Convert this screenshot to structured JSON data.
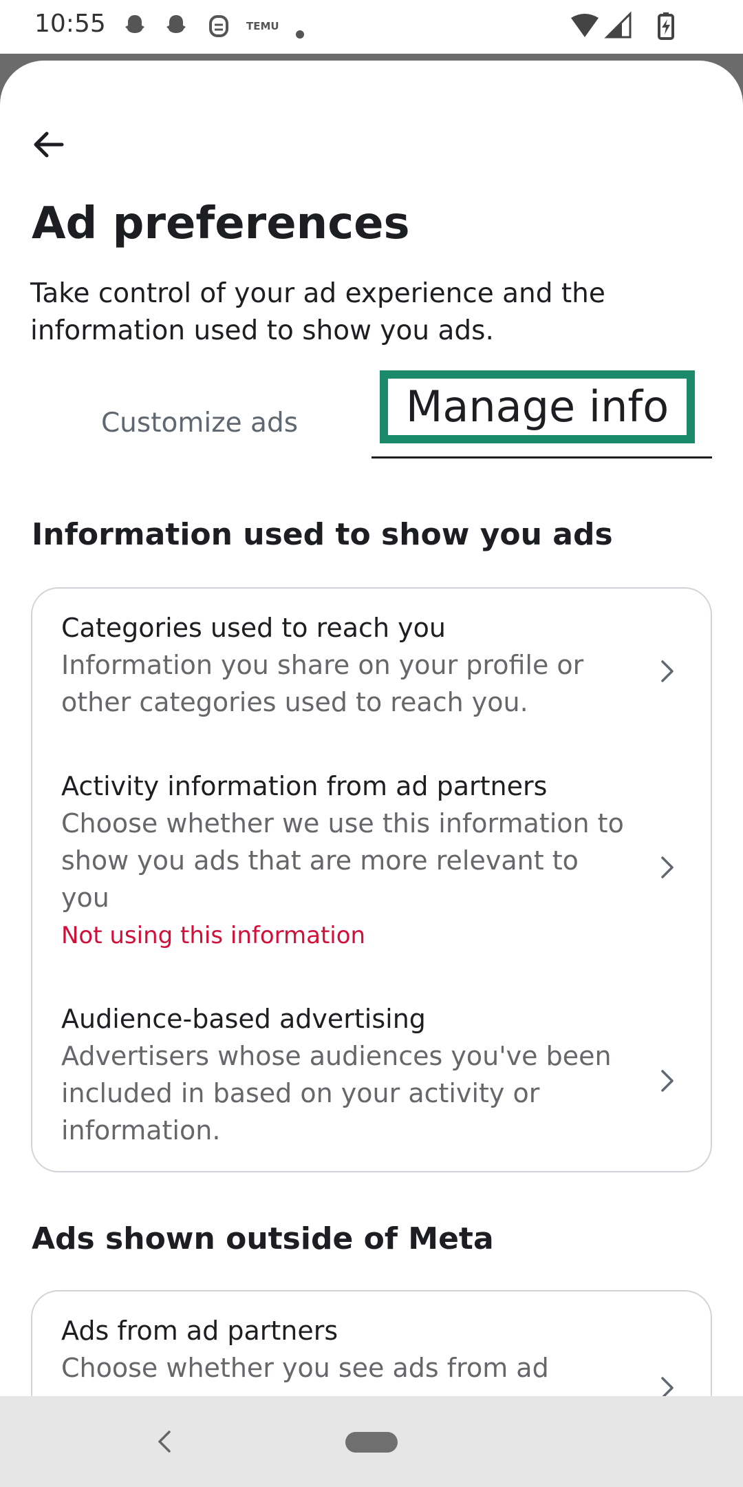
{
  "status_bar": {
    "time": "10:55",
    "temu_label": "TEMU"
  },
  "header": {
    "title": "Ad preferences",
    "subtitle": "Take control of your ad experience and the information used to show you ads."
  },
  "tabs": [
    {
      "label": "Customize ads",
      "selected": false
    },
    {
      "label": "Manage info",
      "selected": true
    }
  ],
  "section1": {
    "heading": "Information used to show you ads",
    "items": [
      {
        "title": "Categories used to reach you",
        "desc": "Information you share on your profile or other categories used to reach you."
      },
      {
        "title": "Activity information from ad partners",
        "desc": "Choose whether we use this information to show you ads that are more relevant to you",
        "status": "Not using this information"
      },
      {
        "title": "Audience-based advertising",
        "desc": "Advertisers whose audiences you've been included in based on your activity or information."
      }
    ]
  },
  "section2": {
    "heading": "Ads shown outside of Meta",
    "items": [
      {
        "title": "Ads from ad partners",
        "desc": "Choose whether you see ads from ad"
      }
    ]
  },
  "colors": {
    "highlight_border": "#1b8a6b",
    "status_red": "#d20f39",
    "muted_text": "#65676b"
  }
}
